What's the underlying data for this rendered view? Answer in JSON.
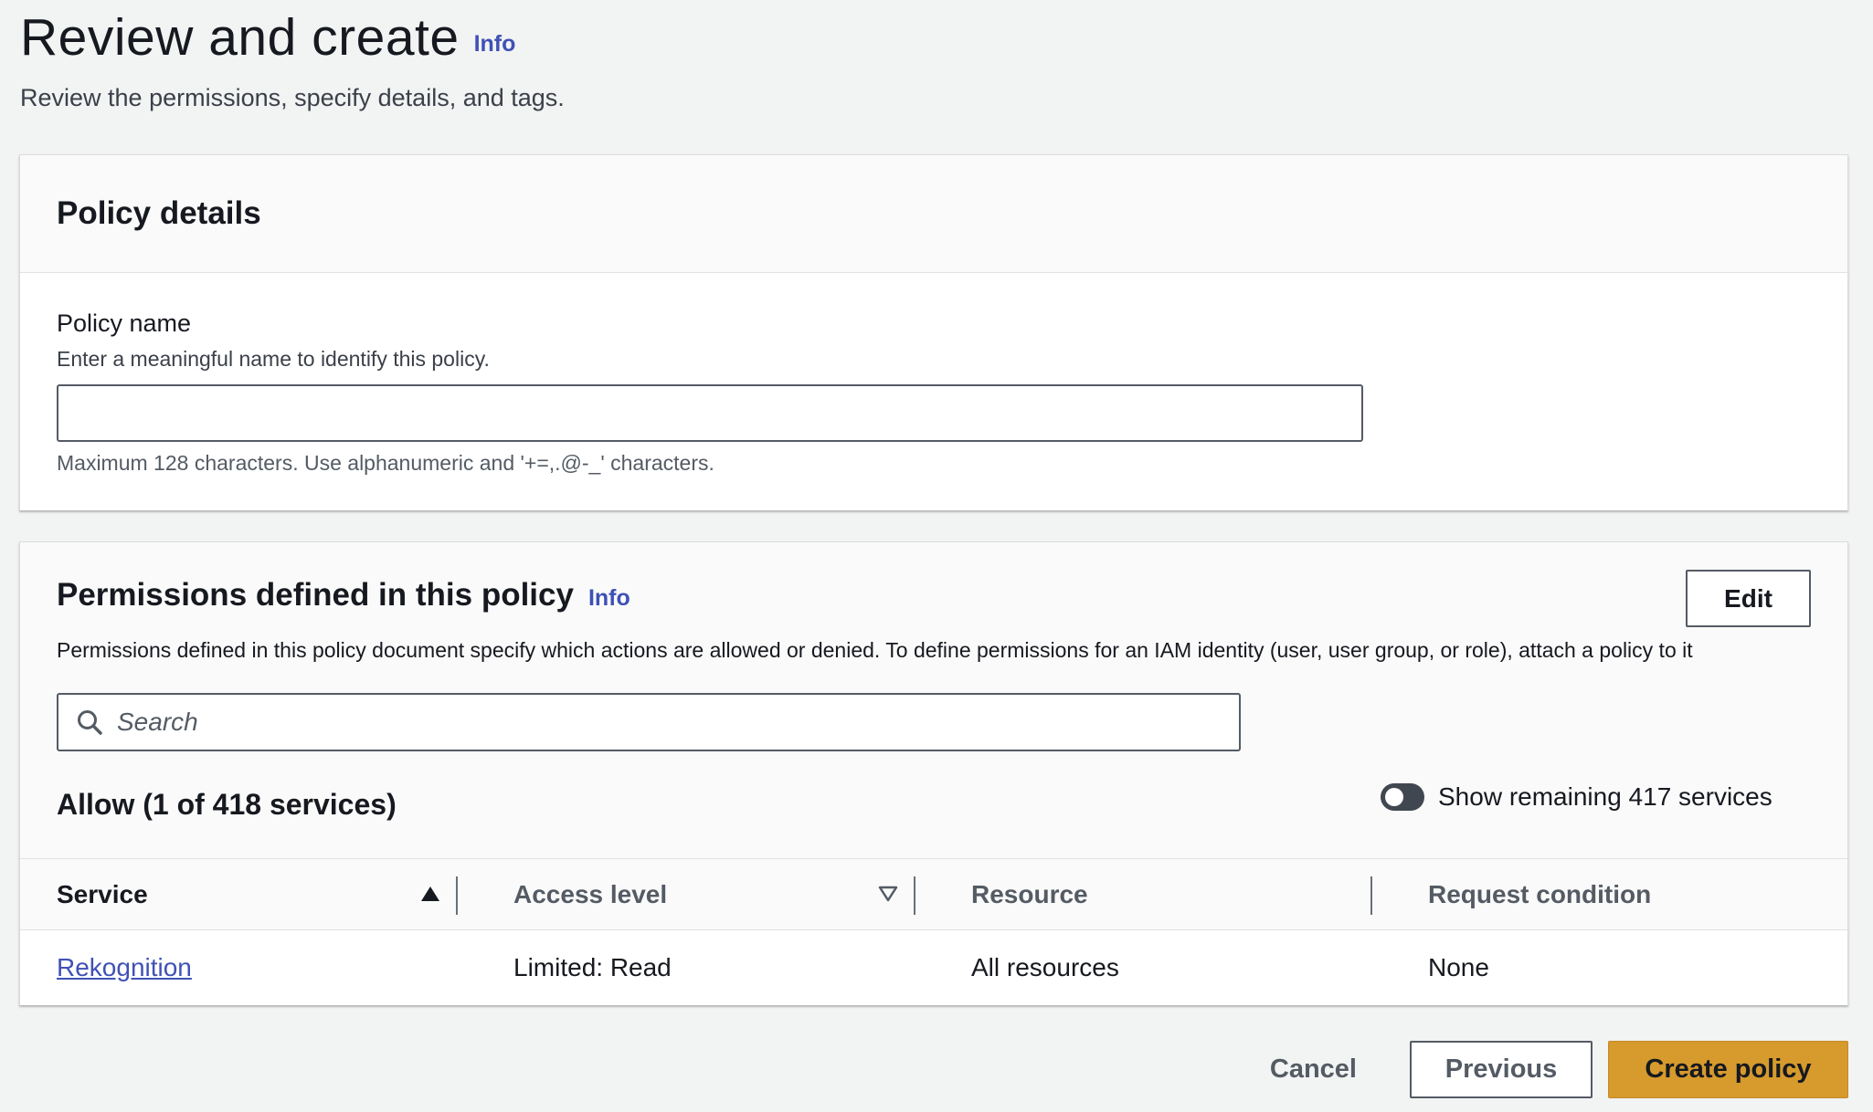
{
  "page": {
    "title": "Review and create",
    "info_label": "Info",
    "description": "Review the permissions, specify details, and tags."
  },
  "policy_details": {
    "heading": "Policy details",
    "name_label": "Policy name",
    "name_description": "Enter a meaningful name to identify this policy.",
    "name_value": "",
    "name_constraint": "Maximum 128 characters. Use alphanumeric and '+=,.@-_' characters."
  },
  "permissions": {
    "heading": "Permissions defined in this policy",
    "info_label": "Info",
    "edit_label": "Edit",
    "description": "Permissions defined in this policy document specify which actions are allowed or denied. To define permissions for an IAM identity (user, user group, or role), attach a policy to it",
    "search_placeholder": "Search",
    "allow_title": "Allow (1 of 418 services)",
    "toggle_label": "Show remaining 417 services",
    "toggle_on": false,
    "table": {
      "columns": [
        "Service",
        "Access level",
        "Resource",
        "Request condition"
      ],
      "rows": [
        {
          "service": "Rekognition",
          "access_level": "Limited: Read",
          "resource": "All resources",
          "request_condition": "None"
        }
      ]
    }
  },
  "actions": {
    "cancel_label": "Cancel",
    "previous_label": "Previous",
    "create_label": "Create policy"
  },
  "colors": {
    "page_bg": "#f2f3f3",
    "link": "#3f51b5",
    "primary_button": "#d69a2d",
    "text": "#16191f"
  },
  "icons": {
    "search": "search-icon",
    "sort_ascending": "caret-up-icon",
    "sort_unsorted": "caret-down-outline-icon"
  }
}
